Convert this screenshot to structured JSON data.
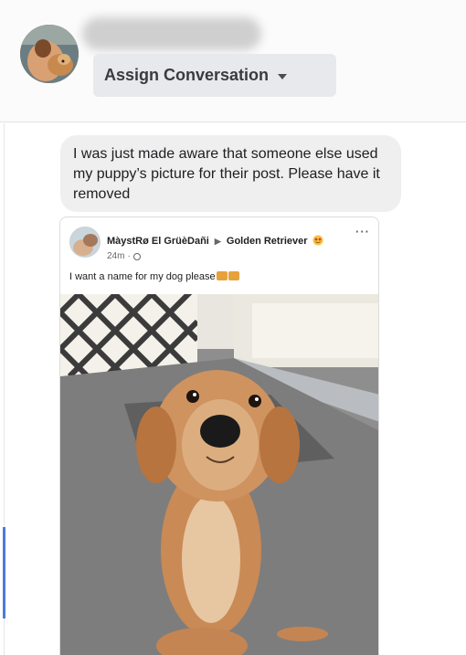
{
  "header": {
    "assign_label": "Assign Conversation"
  },
  "message": {
    "text": "I was just made aware that someone else used my puppy’s picture for their post. Please have it removed"
  },
  "post": {
    "author": "MàystRø El GrüèDañi",
    "arrow": "▶",
    "group": "Golden Retriever",
    "time": "24m",
    "text": "I want a name for my dog please",
    "more": "···"
  },
  "icons": {
    "caret": "caret-down-icon",
    "globe": "globe-icon",
    "more": "more-options-icon"
  },
  "colors": {
    "accent": "#4a7cdb",
    "bubble": "#efefef",
    "button": "#e8e9ec"
  }
}
